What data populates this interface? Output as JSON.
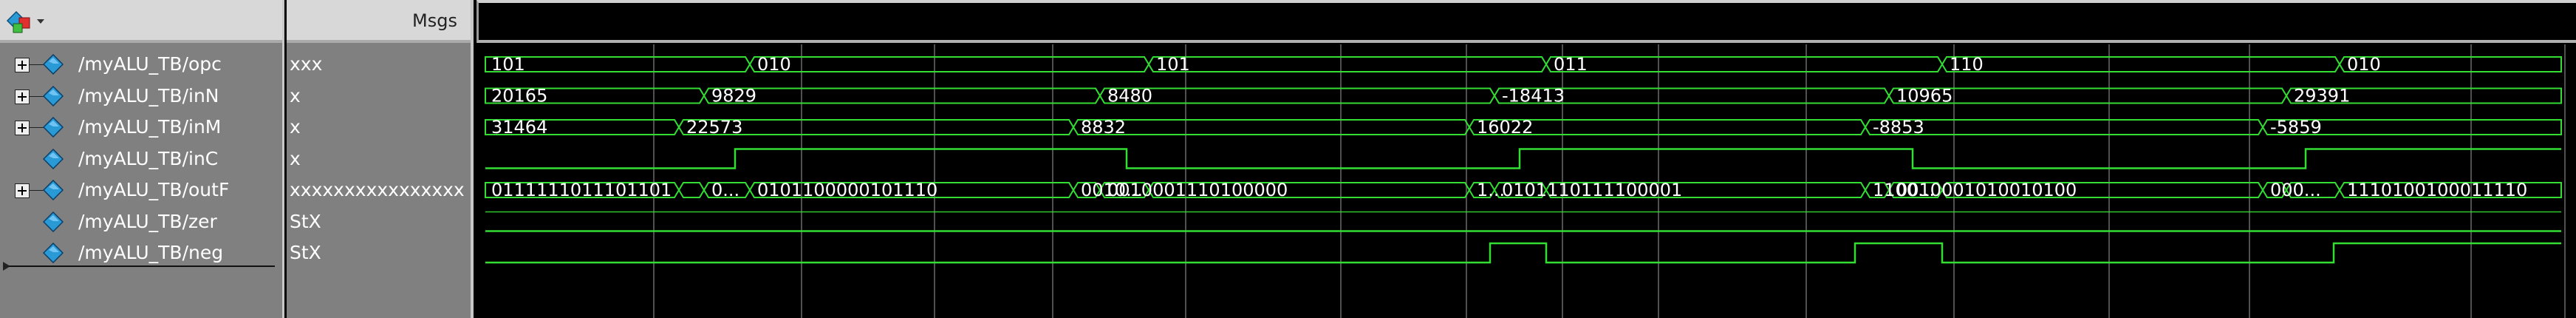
{
  "header": {
    "msgs_label": "Msgs",
    "logo_icon": "wave-window-logo-icon"
  },
  "signals": [
    {
      "name": "/myALU_TB/opc",
      "value": "xxx",
      "expandable": true,
      "kind": "bus"
    },
    {
      "name": "/myALU_TB/inN",
      "value": "x",
      "expandable": true,
      "kind": "bus"
    },
    {
      "name": "/myALU_TB/inM",
      "value": "x",
      "expandable": true,
      "kind": "bus"
    },
    {
      "name": "/myALU_TB/inC",
      "value": "x",
      "expandable": false,
      "kind": "bit"
    },
    {
      "name": "/myALU_TB/outF",
      "value": "xxxxxxxxxxxxxxxx",
      "expandable": true,
      "kind": "bus"
    },
    {
      "name": "/myALU_TB/zer",
      "value": "StX",
      "expandable": false,
      "kind": "bit"
    },
    {
      "name": "/myALU_TB/neg",
      "value": "StX",
      "expandable": false,
      "kind": "bit"
    }
  ],
  "waves": {
    "opc": {
      "labels": [
        "101",
        "010",
        "101",
        "011",
        "110",
        "010"
      ]
    },
    "inN": {
      "labels": [
        "20165",
        "9829",
        "8480",
        "-18413",
        "10965",
        "29391"
      ]
    },
    "inM": {
      "labels": [
        "31464",
        "22573",
        "8832",
        "16022",
        "-8853",
        "-5859"
      ]
    },
    "outF": {
      "labels": [
        "0111111011101101",
        "0...",
        "0101100000101110",
        "0010...",
        "0010001110100000",
        "1...",
        "0101110111100001",
        "1100...",
        "0010001010010100",
        "000...",
        "1110100100011110"
      ]
    }
  },
  "colors": {
    "wave": "#33dd33",
    "panel": "#808080",
    "background": "#000000",
    "signal_icon": "#2a9ad6"
  }
}
